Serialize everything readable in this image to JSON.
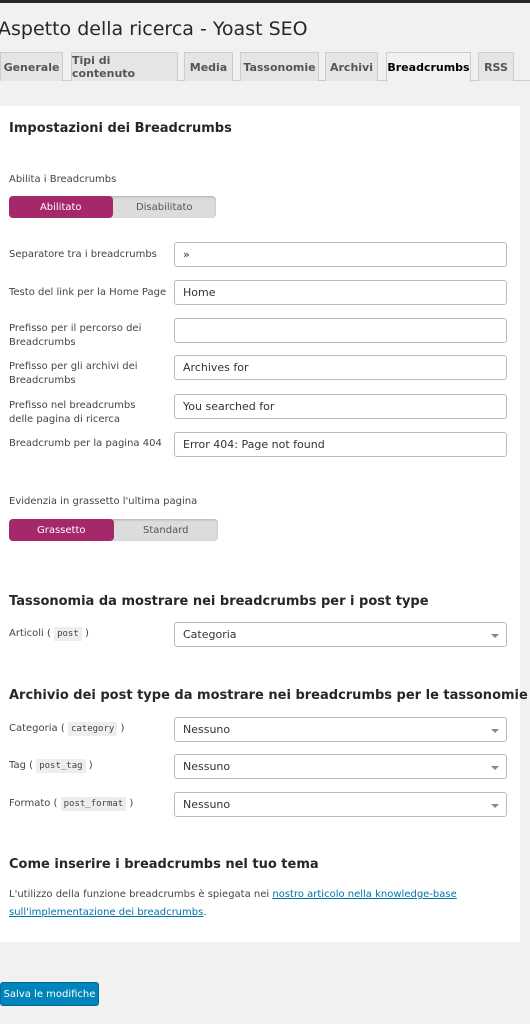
{
  "title": "Aspetto della ricerca - Yoast SEO",
  "tabs": [
    "Generale",
    "Tipi di contenuto",
    "Media",
    "Tassonomie",
    "Archivi",
    "Breadcrumbs",
    "RSS"
  ],
  "active_tab": "Breadcrumbs",
  "section1": {
    "heading": "Impostazioni dei Breadcrumbs",
    "enable_label": "Abilita i Breadcrumbs",
    "enable_on": "Abilitato",
    "enable_off": "Disabilitato",
    "fields": [
      {
        "label": "Separatore tra i breadcrumbs",
        "value": "»"
      },
      {
        "label": "Testo del link per la Home Page",
        "value": "Home"
      },
      {
        "label": "Prefisso per il percorso dei Breadcrumbs",
        "value": ""
      },
      {
        "label": "Prefisso per gli archivi dei Breadcrumbs",
        "value": "Archives for"
      },
      {
        "label": "Prefisso nel breadcrumbs delle pagina di ricerca",
        "value": "You searched for"
      },
      {
        "label": "Breadcrumb per la pagina 404",
        "value": "Error 404: Page not found"
      }
    ],
    "bold_label": "Evidenzia in grassetto l'ultima pagina",
    "bold_on": "Grassetto",
    "bold_off": "Standard"
  },
  "section2": {
    "heading": "Tassonomia da mostrare nei breadcrumbs per i post type",
    "rows": [
      {
        "label": "Articoli",
        "code": "post",
        "value": "Categoria"
      }
    ]
  },
  "section3": {
    "heading": "Archivio dei post type da mostrare nei breadcrumbs per le tassonomie",
    "rows": [
      {
        "label": "Categoria",
        "code": "category",
        "value": "Nessuno"
      },
      {
        "label": "Tag",
        "code": "post_tag",
        "value": "Nessuno"
      },
      {
        "label": "Formato",
        "code": "post_format",
        "value": "Nessuno"
      }
    ]
  },
  "section4": {
    "heading": "Come inserire i breadcrumbs nel tuo tema",
    "text": "L'utilizzo della funzione breadcrumbs è spiegata nei ",
    "link": "nostro articolo nella knowledge-base sull'implementazione dei breadcrumbs",
    "after": "."
  },
  "save_label": "Salva le modifiche",
  "colors": {
    "accent": "#a4286a",
    "primary_button": "#0085ba"
  }
}
